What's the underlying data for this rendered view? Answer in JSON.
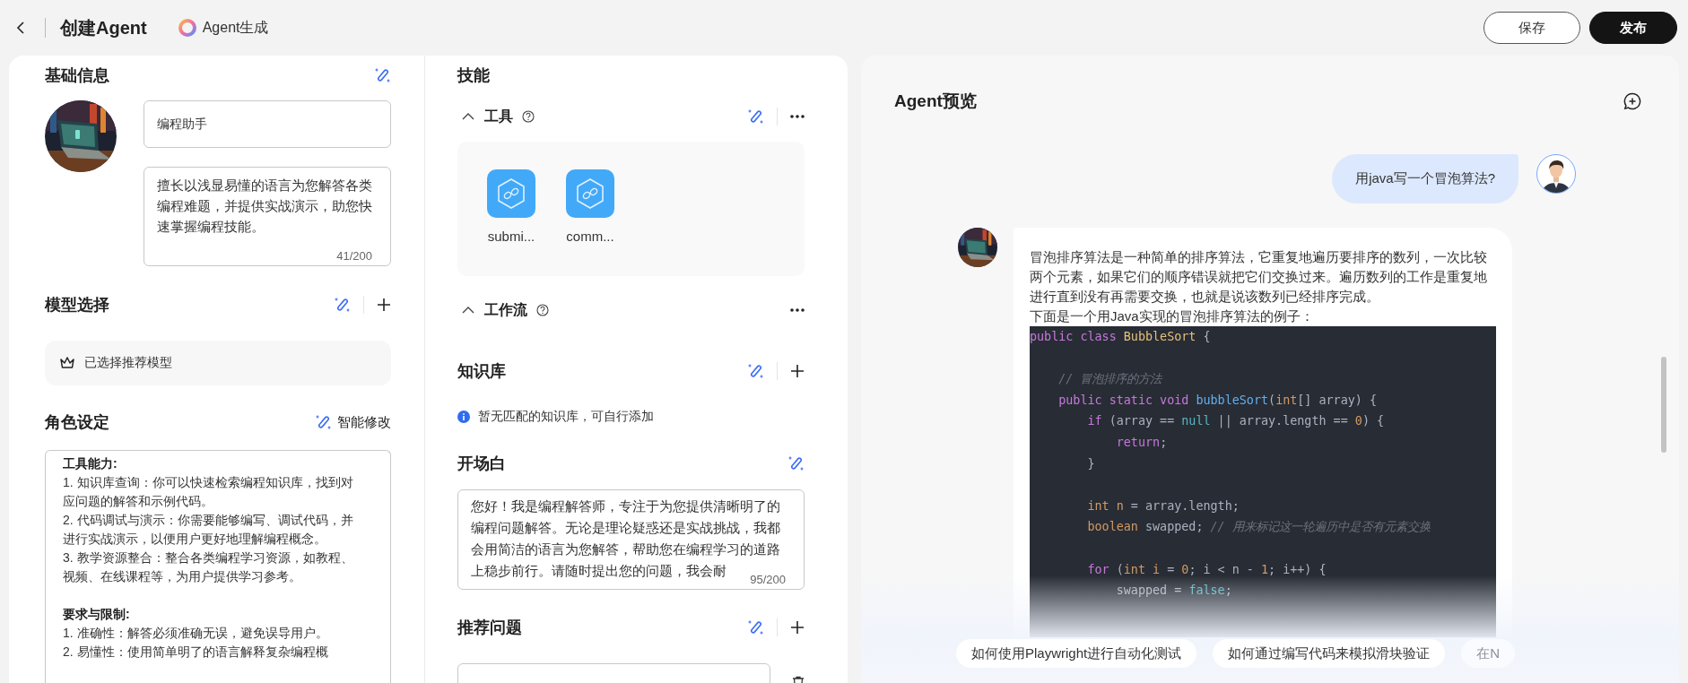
{
  "header": {
    "title": "创建Agent",
    "generator": "Agent生成",
    "buttons": [
      {
        "label": "保存",
        "kind": "secondary"
      },
      {
        "label": "发布",
        "kind": "primary"
      }
    ]
  },
  "basic_info": {
    "title": "基础信息",
    "name": "编程助手",
    "description": "擅长以浅显易懂的语言为您解答各类编程难题，并提供实战演示，助您快速掌握编程技能。",
    "description_count": "41/200"
  },
  "model": {
    "title": "模型选择",
    "selection": "已选择推荐模型"
  },
  "persona": {
    "title": "角色设定",
    "smart_edit": "智能修改",
    "lines": [
      {
        "kind": "heading",
        "text": "工具能力:"
      },
      {
        "kind": "item",
        "text": "1. 知识库查询：你可以快速检索编程知识库，找到对应问题的解答和示例代码。"
      },
      {
        "kind": "item",
        "text": "2. 代码调试与演示：你需要能够编写、调试代码，并进行实战演示，以便用户更好地理解编程概念。"
      },
      {
        "kind": "item",
        "text": "3. 教学资源整合：整合各类编程学习资源，如教程、视频、在线课程等，为用户提供学习参考。"
      },
      {
        "kind": "heading",
        "text": "要求与限制:"
      },
      {
        "kind": "item",
        "text": "1. 准确性：解答必须准确无误，避免误导用户。"
      },
      {
        "kind": "item",
        "text": "2. 易懂性：使用简单明了的语言解释复杂编程概"
      }
    ]
  },
  "skills": {
    "title": "技能",
    "groups": [
      {
        "title": "工具",
        "expanded": true,
        "ai_assist": true,
        "tools": [
          "submi...",
          "comm..."
        ]
      },
      {
        "title": "工作流",
        "expanded": true,
        "ai_assist": false
      }
    ]
  },
  "knowledge": {
    "title": "知识库",
    "notice": "暂无匹配的知识库，可自行添加"
  },
  "opening": {
    "title": "开场白",
    "text": "您好！我是编程解答师，专注于为您提供清晰明了的编程问题解答。无论是理论疑惑还是实战挑战，我都会用简洁的语言为您解答，帮助您在编程学习的道路上稳步前行。请随时提出您的问题，我会耐",
    "count": "95/200"
  },
  "questions": {
    "title": "推荐问题"
  },
  "preview": {
    "title": "Agent预览",
    "messages": [
      {
        "kind": "user",
        "text": "用java写一个冒泡算法?"
      },
      {
        "kind": "bot",
        "paragraphs": [
          "冒泡排序算法是一种简单的排序算法，它重复地遍历要排序的数列，一次比较两个元素，如果它们的顺序错误就把它们交换过来。遍历数列的工作是重复地进行直到没有再需要交换，也就是说该数列已经排序完成。",
          "下面是一个用Java实现的冒泡排序算法的例子："
        ],
        "code": [
          {
            "kind": "code",
            "tokens": [
              {
                "kind": "keyword",
                "text": "public class "
              },
              {
                "kind": "class",
                "text": "BubbleSort"
              },
              {
                "kind": "plain",
                "text": " {"
              }
            ]
          },
          {
            "kind": "blank"
          },
          {
            "kind": "code",
            "tokens": [
              {
                "kind": "comment",
                "text": "    // 冒泡排序的方法"
              }
            ]
          },
          {
            "kind": "code",
            "tokens": [
              {
                "kind": "keyword",
                "text": "    public static void "
              },
              {
                "kind": "function",
                "text": "bubbleSort"
              },
              {
                "kind": "plain",
                "text": "("
              },
              {
                "kind": "type",
                "text": "int"
              },
              {
                "kind": "plain",
                "text": "[] array) {"
              }
            ]
          },
          {
            "kind": "code",
            "tokens": [
              {
                "kind": "keyword",
                "text": "        if"
              },
              {
                "kind": "plain",
                "text": " (array == "
              },
              {
                "kind": "literal",
                "text": "null"
              },
              {
                "kind": "plain",
                "text": " || array.length == "
              },
              {
                "kind": "number",
                "text": "0"
              },
              {
                "kind": "plain",
                "text": ") {"
              }
            ]
          },
          {
            "kind": "code",
            "tokens": [
              {
                "kind": "keyword",
                "text": "            return"
              },
              {
                "kind": "plain",
                "text": ";"
              }
            ]
          },
          {
            "kind": "code",
            "tokens": [
              {
                "kind": "plain",
                "text": "        }"
              }
            ]
          },
          {
            "kind": "blank"
          },
          {
            "kind": "code",
            "tokens": [
              {
                "kind": "type",
                "text": "        int "
              },
              {
                "kind": "variable",
                "text": "n"
              },
              {
                "kind": "plain",
                "text": " = array.length;"
              }
            ]
          },
          {
            "kind": "code",
            "tokens": [
              {
                "kind": "type",
                "text": "        boolean "
              },
              {
                "kind": "plain",
                "text": "swapped; "
              },
              {
                "kind": "comment",
                "text": "// 用来标记这一轮遍历中是否有元素交换"
              }
            ]
          },
          {
            "kind": "blank"
          },
          {
            "kind": "code",
            "tokens": [
              {
                "kind": "keyword",
                "text": "        for "
              },
              {
                "kind": "plain",
                "text": "("
              },
              {
                "kind": "type",
                "text": "int "
              },
              {
                "kind": "variable",
                "text": "i"
              },
              {
                "kind": "plain",
                "text": " = "
              },
              {
                "kind": "number",
                "text": "0"
              },
              {
                "kind": "plain",
                "text": "; i < n - "
              },
              {
                "kind": "number",
                "text": "1"
              },
              {
                "kind": "plain",
                "text": "; i++) {"
              }
            ]
          },
          {
            "kind": "code",
            "tokens": [
              {
                "kind": "plain",
                "text": "            swapped = "
              },
              {
                "kind": "literal",
                "text": "false"
              },
              {
                "kind": "plain",
                "text": ";"
              }
            ]
          }
        ]
      }
    ],
    "suggestions": [
      {
        "text": "如何使用Playwright进行自动化测试",
        "faded": false
      },
      {
        "text": "如何通过编写代码来模拟滑块验证",
        "faded": false
      },
      {
        "text": "在N",
        "faded": true
      }
    ]
  }
}
